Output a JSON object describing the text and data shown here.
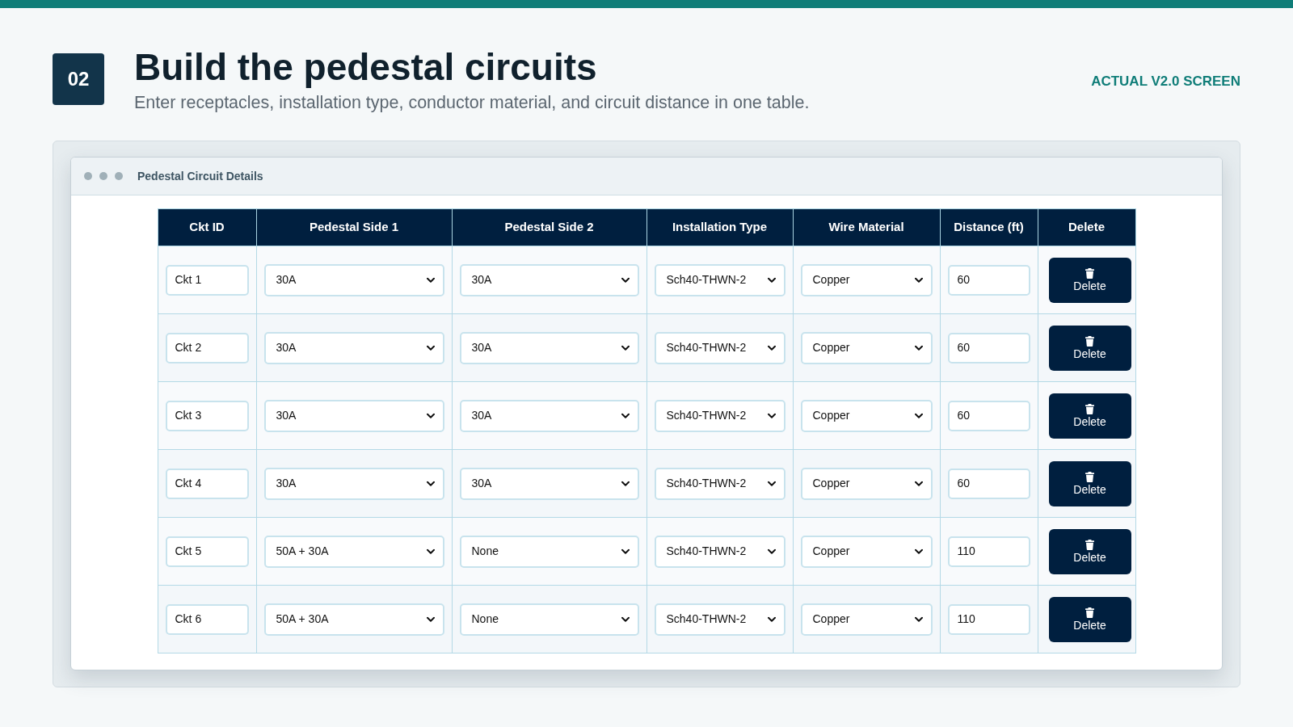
{
  "step": "02",
  "title": "Build the pedestal circuits",
  "subtitle": "Enter receptacles, installation type, conductor material, and circuit distance in one table.",
  "tag": "ACTUAL V2.0 SCREEN",
  "window": {
    "title": "Pedestal Circuit Details",
    "table": {
      "columns": [
        {
          "label": "Ckt ID",
          "kind": "input"
        },
        {
          "label": "Pedestal Side 1",
          "kind": "select"
        },
        {
          "label": "Pedestal Side 2",
          "kind": "select"
        },
        {
          "label": "Installation Type",
          "kind": "select"
        },
        {
          "label": "Wire Material",
          "kind": "select"
        },
        {
          "label": "Distance (ft)",
          "kind": "input"
        },
        {
          "label": "Delete",
          "kind": "button"
        }
      ],
      "rows": [
        [
          "Ckt 1",
          "30A",
          "30A",
          "Sch40-THWN-2",
          "Copper",
          "60",
          "Delete"
        ],
        [
          "Ckt 2",
          "30A",
          "30A",
          "Sch40-THWN-2",
          "Copper",
          "60",
          "Delete"
        ],
        [
          "Ckt 3",
          "30A",
          "30A",
          "Sch40-THWN-2",
          "Copper",
          "60",
          "Delete"
        ],
        [
          "Ckt 4",
          "30A",
          "30A",
          "Sch40-THWN-2",
          "Copper",
          "60",
          "Delete"
        ],
        [
          "Ckt 5",
          "50A + 30A",
          "None",
          "Sch40-THWN-2",
          "Copper",
          "110",
          "Delete"
        ],
        [
          "Ckt 6",
          "50A + 30A",
          "None",
          "Sch40-THWN-2",
          "Copper",
          "110",
          "Delete"
        ]
      ]
    }
  }
}
